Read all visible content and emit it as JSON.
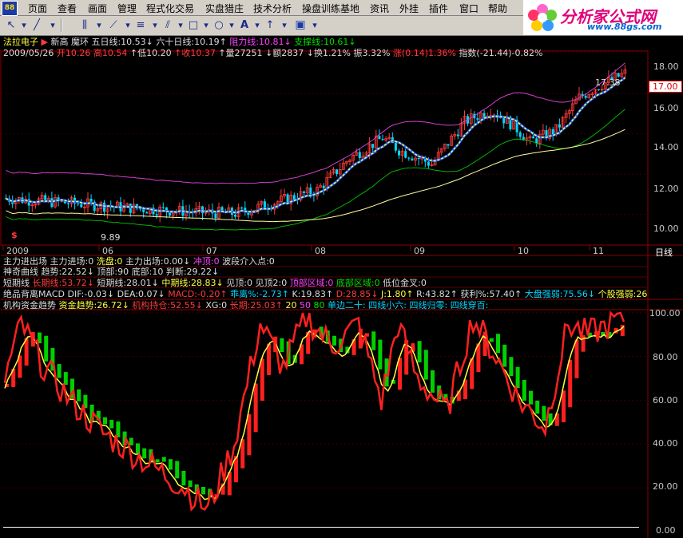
{
  "app": {
    "icon_text": "88",
    "menu": [
      "页面",
      "查看",
      "画面",
      "管理",
      "程式化交易",
      "实盘猎庄",
      "技术分析",
      "操盘训练基地",
      "资讯",
      "外挂",
      "插件",
      "窗口",
      "帮助"
    ]
  },
  "toolbar": {
    "icons": [
      "pointer-icon",
      "crosshair-icon",
      "line-draw-icon",
      "parallel-lines-icon",
      "fan-lines-icon",
      "fibonacci-icon",
      "channel-icon",
      "rectangle-icon",
      "ellipse-icon",
      "text-tool-icon",
      "arrow-tool-icon",
      "save-icon"
    ]
  },
  "logo": {
    "title": "分析家公式网",
    "url": "www.88gs.com"
  },
  "main_panel": {
    "stock_name": "法拉电子",
    "new_high": "新高",
    "demon_ring": "魔环",
    "ma5": "五日线:10.53↓",
    "ma60": "六十日线:10.19↑",
    "resistance": "阻力线:10.81↓",
    "support": "支撑线:10.61↓",
    "date": "2009/05/26",
    "open": "开10.26",
    "high": "高10.54",
    "low": "↑低10.20",
    "close": "↑收10.37",
    "volume": "↑量27251",
    "amount": "↓额2837",
    "turnover": "↓换1.21%",
    "amplitude": "振3.32%",
    "change": "涨(0.14)1.36%",
    "index": "指数(-21.44)-0.82%",
    "y_ticks": [
      "18.00",
      "16.00",
      "14.00",
      "12.00",
      "10.00"
    ],
    "price_marker": "17.00",
    "annotation_high": "17.38",
    "annotation_low": "9.89",
    "x_labels": [
      "2009",
      "06",
      "07",
      "08",
      "09",
      "10",
      "11"
    ],
    "x_unit": "日线"
  },
  "indicator_lines": {
    "line1": [
      "主力进出场",
      "主力进场:0",
      "洗盘:0",
      "主力出场:0.00↓",
      "冲顶:0",
      "波段介入点:0"
    ],
    "line2": [
      "神奇曲线",
      "趋势:22.52↓",
      "顶部:90",
      "底部:10",
      "判断:29.22↓"
    ],
    "line3": [
      "短期线",
      "长期线:53.72↓",
      "短期线:28.01↓",
      "中期线:28.83↓",
      "见顶:0",
      "见顶2:0",
      "顶部区域:0",
      "底部区域:0",
      "低位金叉:0"
    ],
    "line4": [
      "绝品背离MACD",
      "DIF:-0.03↓",
      "DEA:0.07↓",
      "MACD:-0.20↑",
      "乖离%:-2.73↑",
      "K:19.83↑",
      "D:28.85↓",
      "J:1.80↑",
      "R:43.82↑",
      "获利%:57.40↑",
      "大盘强弱:75.56↓",
      "个股强弱:26"
    ],
    "line5": [
      "机构资金趋势",
      "资金趋势:26.72↓",
      "机构持仓:52.55↓",
      "XG:0",
      "长期:25.03↑",
      "20",
      "50",
      "80",
      "单边二十:",
      "四线小六:",
      "四线归零:",
      "四线穿百:"
    ]
  },
  "lower_panel": {
    "y_ticks": [
      "100.00",
      "80.00",
      "60.00",
      "40.00",
      "20.00",
      "0.00"
    ]
  },
  "colors": {
    "candle_up": "#ff3b3b",
    "candle_down": "#00d8ff",
    "ma_blue": "#1e5cff",
    "ma_yellow": "#ffff40",
    "upper_band": "#d040d0",
    "lower_band": "#00b400",
    "long_ma": "#ffffa0",
    "osc_red": "#ff2020",
    "osc_yellow": "#ffff40",
    "bar_green": "#00d000",
    "bar_red": "#ff2020"
  }
}
